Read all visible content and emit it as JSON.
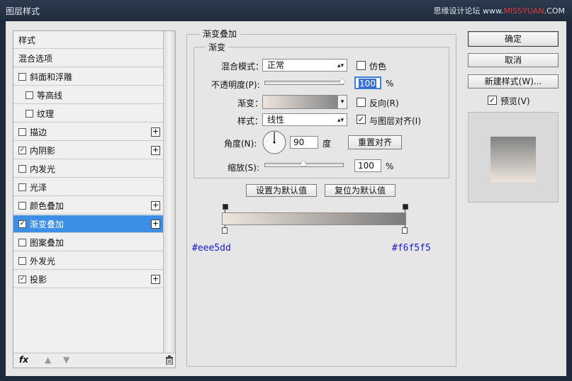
{
  "window": {
    "title": "图层样式"
  },
  "watermark": {
    "site": "思缘设计论坛",
    "domain_prefix": "www.",
    "domain_red": "MISSYUAN",
    "domain_suffix": ".COM"
  },
  "styles_list": {
    "header": "样式",
    "blend_options": "混合选项",
    "items": [
      {
        "label": "斜面和浮雕",
        "checked": false,
        "indent": false,
        "plus": false
      },
      {
        "label": "等高线",
        "checked": false,
        "indent": true,
        "plus": false
      },
      {
        "label": "纹理",
        "checked": false,
        "indent": true,
        "plus": false
      },
      {
        "label": "描边",
        "checked": false,
        "indent": false,
        "plus": true
      },
      {
        "label": "内阴影",
        "checked": true,
        "indent": false,
        "plus": true
      },
      {
        "label": "内发光",
        "checked": false,
        "indent": false,
        "plus": false
      },
      {
        "label": "光泽",
        "checked": false,
        "indent": false,
        "plus": false
      },
      {
        "label": "颜色叠加",
        "checked": false,
        "indent": false,
        "plus": true
      },
      {
        "label": "渐变叠加",
        "checked": true,
        "indent": false,
        "plus": true,
        "selected": true
      },
      {
        "label": "图案叠加",
        "checked": false,
        "indent": false,
        "plus": false
      },
      {
        "label": "外发光",
        "checked": false,
        "indent": false,
        "plus": false
      },
      {
        "label": "投影",
        "checked": true,
        "indent": false,
        "plus": true
      }
    ],
    "footer": {
      "fx_label": "fx"
    }
  },
  "panel": {
    "group_title": "渐变叠加",
    "subgroup_title": "渐变",
    "blend_mode": {
      "label": "混合模式：",
      "value": "正常"
    },
    "dither": {
      "label": "仿色",
      "checked": false
    },
    "opacity": {
      "label": "不透明度(P):",
      "value": "100",
      "unit": "%",
      "fraction": 1.0
    },
    "gradient": {
      "label": "渐变：",
      "color_left": "#eee5dd",
      "color_right": "#7a7a7a"
    },
    "reverse": {
      "label": "反向(R)",
      "checked": false
    },
    "style": {
      "label": "样式：",
      "value": "线性"
    },
    "align": {
      "label": "与图层对齐(I)",
      "checked": true
    },
    "angle": {
      "label": "角度(N):",
      "value": "90",
      "unit": "度"
    },
    "reset_align": "重置对齐",
    "scale": {
      "label": "缩放(S):",
      "value": "100",
      "unit": "%",
      "fraction": 0.5
    },
    "set_default": "设置为默认值",
    "reset_default": "复位为默认值"
  },
  "gradient_editor": {
    "color_start": "#eee5dd",
    "color_end": "#7b7b7b",
    "stop_left_hex": "#eee5dd",
    "stop_right_hex": "#f6f5f5"
  },
  "buttons": {
    "ok": "确定",
    "cancel": "取消",
    "new_style": "新建样式(W)...",
    "preview": {
      "label": "预览(V)",
      "checked": true
    }
  },
  "preview_swatch": {
    "top": "#828282",
    "bottom": "#eee5dd"
  }
}
